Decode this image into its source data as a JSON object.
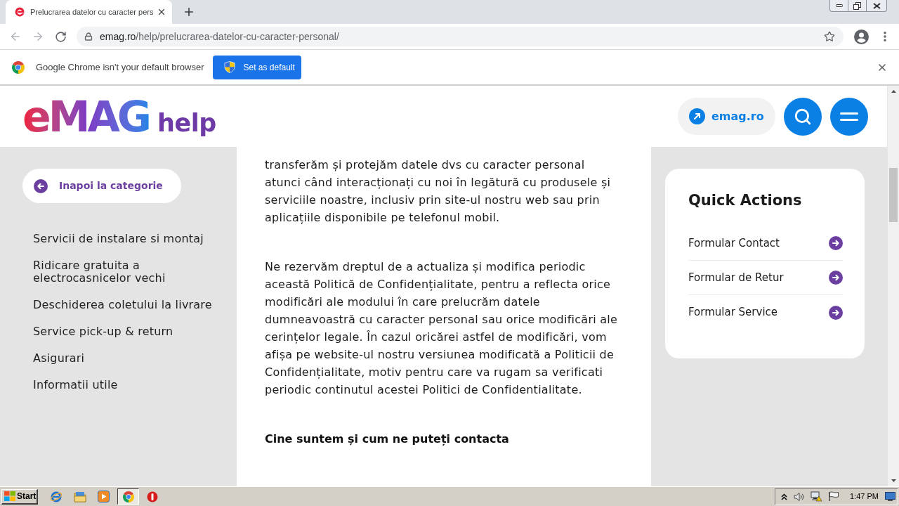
{
  "browser": {
    "tab": {
      "title": "Prelucrarea datelor cu caracter pers"
    },
    "address_bar": {
      "domain": "emag.ro",
      "path": "/help/prelucrarea-datelor-cu-caracter-personal/"
    },
    "infobar": {
      "message": "Google Chrome isn't your default browser",
      "button": "Set as default"
    }
  },
  "site_header": {
    "logo": {
      "brand": "eMAG",
      "suffix": "help"
    },
    "site_link": "emag.ro"
  },
  "sidebar": {
    "back_button": "Inapoi la categorie",
    "items": [
      "Servicii de instalare si montaj",
      "Ridicare gratuita a electrocasnicelor vechi",
      "Deschiderea coletului la livrare",
      "Service pick-up & return",
      "Asigurari",
      "Informatii utile"
    ]
  },
  "article": {
    "blocks": [
      {
        "kind": "paragraph",
        "text": "transferăm și protejăm datele dvs cu caracter personal atunci când interacționați cu noi în legătură cu produsele și serviciile noastre, inclusiv prin site-ul nostru web sau prin aplicațiile disponibile pe telefonul mobil."
      },
      {
        "kind": "paragraph",
        "text": "Ne rezervăm dreptul de a actualiza și modifica periodic această Politică de Confidențialitate, pentru a reflecta orice modificări ale modului în care prelucrăm datele dumneavoastră cu caracter personal sau orice modificări ale cerințelor legale. În cazul oricărei astfel de modificări, vom afișa pe website-ul nostru versiunea modificată a Politicii de Confidențialitate, motiv pentru care va rugam sa verificati periodic continutul acestei Politici de Confidentialitate."
      },
      {
        "kind": "heading",
        "text": "Cine suntem și cum ne puteți contacta"
      }
    ]
  },
  "quick_actions": {
    "title": "Quick Actions",
    "items": [
      "Formular Contact",
      "Formular de Retur",
      "Formular Service"
    ]
  },
  "taskbar": {
    "start": "Start",
    "task_buttons": [
      {
        "kind": "chrome",
        "selected": true
      }
    ],
    "clock": "1:47 PM"
  }
}
